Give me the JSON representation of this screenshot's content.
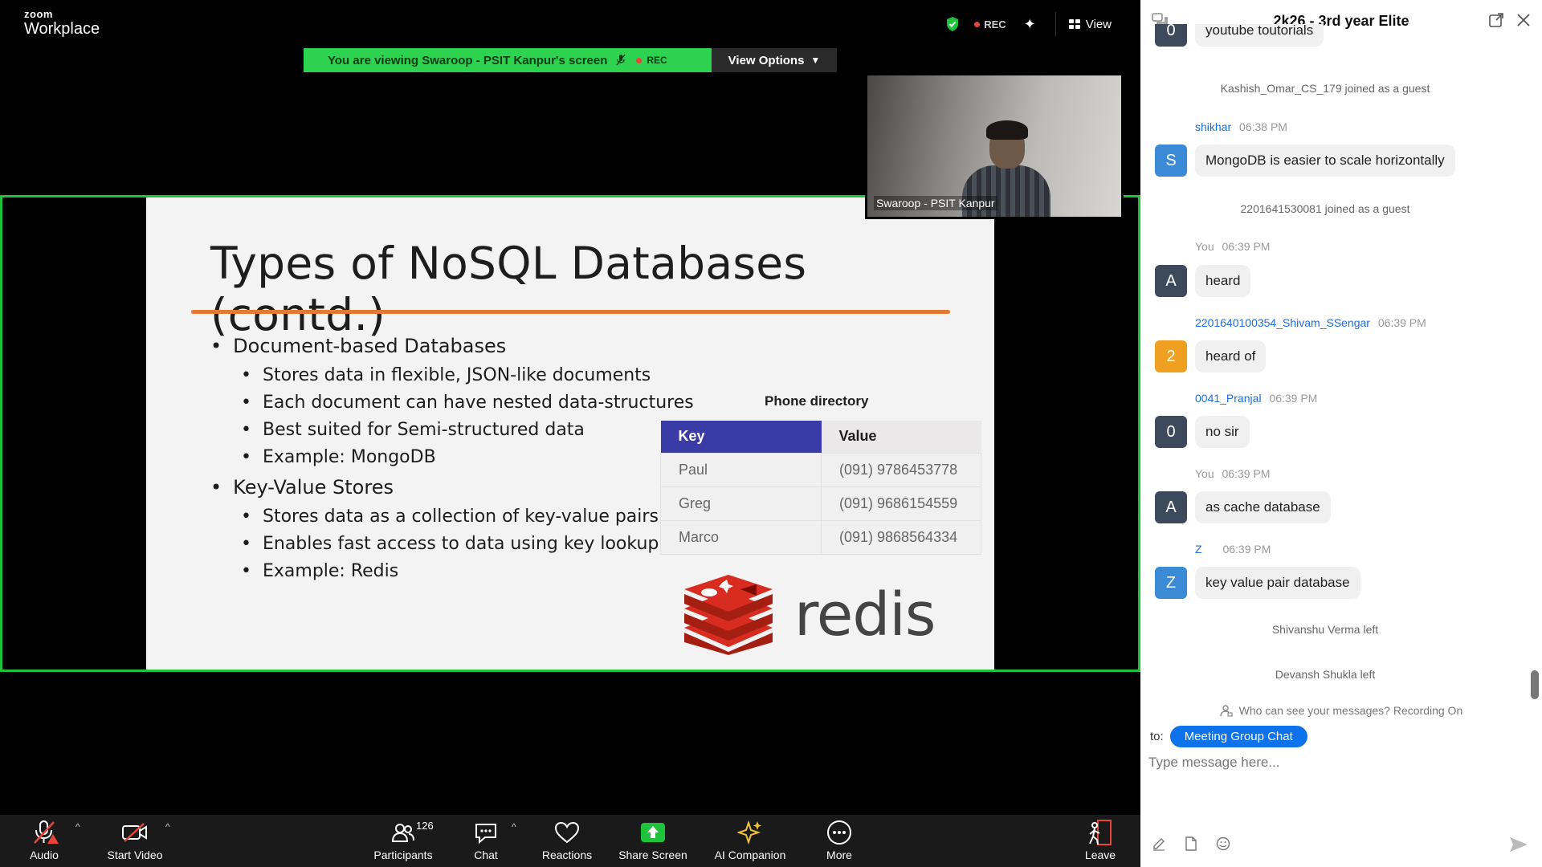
{
  "app": {
    "logo_small": "zoom",
    "logo_big": "Workplace"
  },
  "topbar": {
    "rec_label": "REC",
    "view_label": "View"
  },
  "banner": {
    "text": "You are viewing  Swaroop - PSIT Kanpur's screen",
    "rec_label": "REC",
    "view_options_label": "View Options"
  },
  "slide": {
    "title": "Types of NoSQL Databases (contd.)",
    "bullets": [
      {
        "text": "Document-based Databases",
        "sub": [
          "Stores data in flexible, JSON-like documents",
          "Each document can have nested data-structures",
          "Best suited for Semi-structured data",
          "Example: MongoDB"
        ]
      },
      {
        "text": "Key-Value Stores",
        "sub": [
          "Stores data as a collection of key-value pairs",
          "Enables fast access to data using key lookup",
          "Example: Redis"
        ]
      }
    ],
    "table_title": "Phone directory",
    "table_headers": [
      "Key",
      "Value"
    ],
    "table_rows": [
      [
        "Paul",
        "(091) 9786453778"
      ],
      [
        "Greg",
        "(091) 9686154559"
      ],
      [
        "Marco",
        "(091) 9868564334"
      ]
    ],
    "logo_text": "redis"
  },
  "video": {
    "name": "Swaroop - PSIT Kanpur"
  },
  "toolbar": {
    "audio": "Audio",
    "start_video": "Start Video",
    "participants": "Participants",
    "participants_count": "126",
    "chat": "Chat",
    "reactions": "Reactions",
    "share_screen": "Share Screen",
    "ai_companion": "AI Companion",
    "more": "More",
    "leave": "Leave"
  },
  "chat": {
    "title": "2k26 - 3rd year Elite",
    "partial_message": "youtube toutorials",
    "partial_avatar": "0",
    "system_1": "Kashish_Omar_CS_179 joined as a guest",
    "system_2": "2201641530081 joined as a guest",
    "system_3": "Shivanshu Verma left",
    "system_4": "Devansh Shukla left",
    "messages": [
      {
        "sender": "shikhar",
        "time": "06:38 PM",
        "initial": "S",
        "color": "#3a8ad6",
        "text": "MongoDB is easier to scale horizontally",
        "you": false
      },
      {
        "sender": "You",
        "time": "06:39 PM",
        "initial": "A",
        "color": "#3d4a5c",
        "text": "heard",
        "you": true
      },
      {
        "sender": "2201640100354_Shivam_SSengar",
        "time": "06:39 PM",
        "initial": "2",
        "color": "#f0a020",
        "text": "heard of",
        "you": false
      },
      {
        "sender": "0041_Pranjal",
        "time": "06:39 PM",
        "initial": "0",
        "color": "#3d4a5c",
        "text": "no sir",
        "you": false
      },
      {
        "sender": "You",
        "time": "06:39 PM",
        "initial": "A",
        "color": "#3d4a5c",
        "text": "as cache database",
        "you": true
      },
      {
        "sender": "Z",
        "time": "06:39 PM",
        "initial": "Z",
        "color": "#3a8ad6",
        "text": "key value pair database",
        "you": false
      }
    ],
    "notice": "Who can see your messages? Recording On",
    "to_label": "to:",
    "to_target": "Meeting Group Chat",
    "input_placeholder": "Type message here..."
  }
}
